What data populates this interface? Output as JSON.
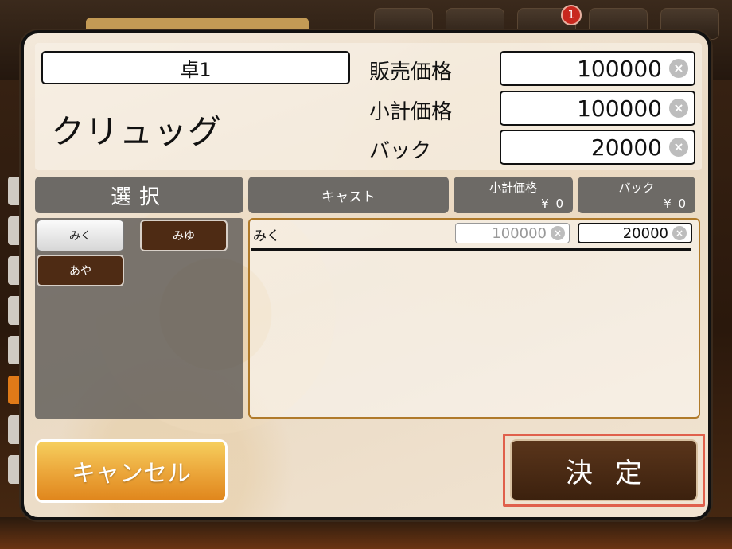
{
  "background": {
    "notification_count": "1"
  },
  "dialog": {
    "table_name": "卓1",
    "product_name": "クリュッグ",
    "prices": [
      {
        "label": "販売価格",
        "value": "100000"
      },
      {
        "label": "小計価格",
        "value": "100000"
      },
      {
        "label": "バック",
        "value": "20000"
      }
    ],
    "clear_glyph": "×",
    "headers": {
      "select": "選択",
      "cast": "キャスト",
      "subtotal": {
        "title": "小計価格",
        "value": "¥ 0"
      },
      "back": {
        "title": "バック",
        "value": "¥ 0"
      }
    },
    "cast_buttons": [
      {
        "label": "みく",
        "style": "light"
      },
      {
        "label": "みゆ",
        "style": "dark"
      },
      {
        "label": "あや",
        "style": "dark"
      }
    ],
    "rows": [
      {
        "name": "みく",
        "subtotal": "100000",
        "back": "20000"
      }
    ],
    "cancel_label": "キャンセル",
    "confirm_label": "決定"
  },
  "colors": {
    "accent_orange": "#eca83c",
    "dark_brown": "#4e2b14",
    "highlight_red": "#e0604c"
  }
}
